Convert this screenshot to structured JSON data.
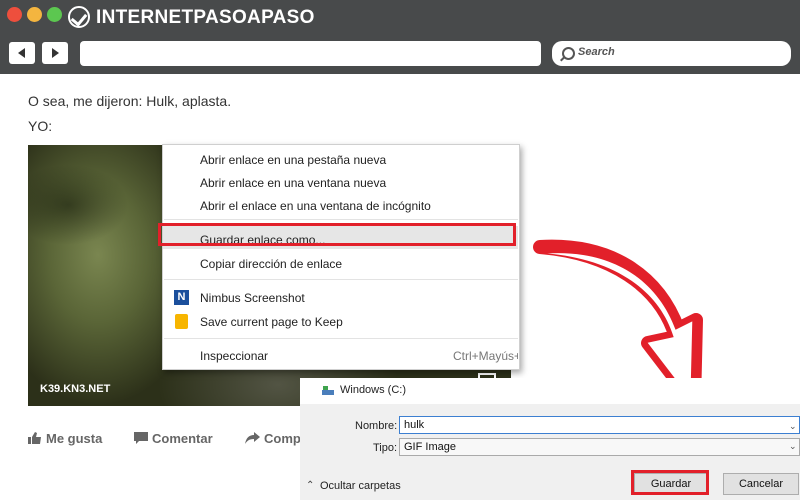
{
  "brand": {
    "prefix": "INTERNET",
    "accent": "PASO",
    "a": "A",
    "suffix": "PASO"
  },
  "search": {
    "placeholder": "Search"
  },
  "post": {
    "line1": "O sea, me dijeron: Hulk, aplasta.",
    "line2": "YO:",
    "watermark": "K39.KN3.NET"
  },
  "actions": {
    "like": "Me gusta",
    "comment": "Comentar",
    "share": "Comp"
  },
  "context_menu": {
    "items": [
      "Abrir enlace en una pestaña nueva",
      "Abrir enlace en una ventana nueva",
      "Abrir el enlace en una ventana de incógnito",
      "Guardar enlace como...",
      "Copiar dirección de enlace",
      "Nimbus Screenshot",
      "Save current page to Keep",
      "Inspeccionar"
    ],
    "shortcut": "Ctrl+Mayús+I"
  },
  "save_dialog": {
    "location": "Windows (C:)",
    "name_label": "Nombre:",
    "name_value": "hulk",
    "type_label": "Tipo:",
    "type_value": "GIF Image",
    "hide_folders": "Ocultar carpetas",
    "save_button": "Guardar",
    "cancel_button": "Cancelar"
  },
  "colors": {
    "chrome": "#484a4b",
    "highlight": "#e2202a"
  },
  "icons": [
    "back-arrow-icon",
    "forward-arrow-icon",
    "search-icon",
    "nimbus-icon",
    "keep-icon",
    "thumbs-up-icon",
    "comment-icon",
    "share-icon",
    "drive-icon",
    "chevron-up-icon"
  ]
}
